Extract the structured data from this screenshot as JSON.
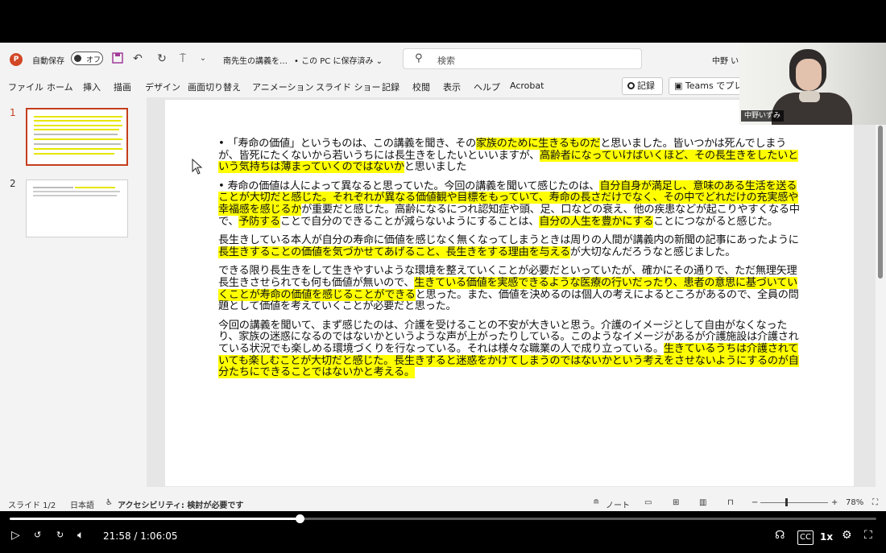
{
  "window": {
    "autosave_label": "自動保存",
    "autosave_state": "オフ",
    "doc_title": "南先生の講義を…",
    "save_state": "• この PC に保存済み ⌄",
    "search_placeholder": "検索",
    "user_name": "中野 い"
  },
  "ribbon": {
    "tabs": [
      "ファイル",
      "ホーム",
      "挿入",
      "描画",
      "デザイン",
      "画面切り替え",
      "アニメーション",
      "スライド ショー",
      "記録",
      "校閲",
      "表示",
      "ヘルプ",
      "Acrobat"
    ],
    "record_button": "記録",
    "teams_button": "Teams でプレ"
  },
  "thumbnails": [
    {
      "number": "1",
      "active": true
    },
    {
      "number": "2",
      "active": false
    }
  ],
  "slide": {
    "paragraphs": [
      [
        {
          "t": "「寿命の価値」というものは、この講義を聞き、その",
          "h": false
        },
        {
          "t": "家族のために生きるものだ",
          "h": true
        },
        {
          "t": "と思いました。皆いつかは死んでしまうが、皆死にたくないから若いうちには長生きをしたいといいますが、",
          "h": false
        },
        {
          "t": "高齢者になっていけばいくほど、その長生きをしたいという気持ちは薄まっていくのではないか",
          "h": true
        },
        {
          "t": "と思いました",
          "h": false
        }
      ],
      [
        {
          "t": "寿命の価値は人によって異なると思っていた。今回の講義を聞いて感じたのは、",
          "h": false
        },
        {
          "t": "自分自身が満足し、意味のある生活を送ることが大切だと感じた。それぞれが異なる価値観や目標をもっていて、寿命の長さだけでなく、その中でどれだけの充実感や幸福感を感じるか",
          "h": true
        },
        {
          "t": "が重要だと感じた。高齢になるにつれ認知症や頭、足、口などの衰え、他の疾患などが起こりやすくなる中で、",
          "h": false
        },
        {
          "t": "予防する",
          "h": true
        },
        {
          "t": "ことで自分のできることが減らないようにすることは、",
          "h": false
        },
        {
          "t": "自分の人生を豊かにする",
          "h": true
        },
        {
          "t": "ことにつながると感じた。",
          "h": false
        }
      ],
      [
        {
          "t": "長生きしている本人が自分の寿命に価値を感じなく無くなってしまうときは周りの人間が講義内の新聞の記事にあったように",
          "h": false
        },
        {
          "t": "長生きすることの価値を気づかせてあげること、長生きをする理由を与える",
          "h": true
        },
        {
          "t": "が大切なんだろうなと感じました。",
          "h": false
        }
      ],
      [
        {
          "t": "できる限り長生きをして生きやすいような環境を整えていくことが必要だといっていたが、確かにその通りで、ただ無理矢理長生きさせられても何も価値が無いので、",
          "h": false
        },
        {
          "t": "生きている価値を実感できるような医療の行いだったり、患者の意思に基づいていくことが寿命の価値を感じることができる",
          "h": true
        },
        {
          "t": "と思った。また、価値を決めるのは個人の考えによるところがあるので、全員の問題として価値を考えていくことが必要だと思った。",
          "h": false
        }
      ],
      [
        {
          "t": "今回の講義を聞いて、まず感じたのは、介護を受けることの不安が大きいと思う。介護のイメージとして自由がなくなったり、家族の迷惑になるのではないかというような声が上がったりしている。このようなイメージがあるが介護施設は介護されている状況でも楽しめる環境づくりを行なっている。それは様々な職業の人で成り立っている。",
          "h": false
        },
        {
          "t": "生きているうちは介護されていても楽しむことが大切だと感じた。長生きすると迷惑をかけてしまうのではないかという考えをさせないようにするのが自分たちにできることではないかと考える。",
          "h": true
        }
      ]
    ]
  },
  "statusbar": {
    "slide_count": "スライド 1/2",
    "language": "日本語",
    "accessibility": "アクセシビリティ: 検討が必要です",
    "notes": "ノート",
    "zoom": "78%"
  },
  "webcam": {
    "name": "中野いずみ"
  },
  "player": {
    "time": "21:58 / 1:06:05",
    "progress": 0.335,
    "speed": "1x"
  }
}
